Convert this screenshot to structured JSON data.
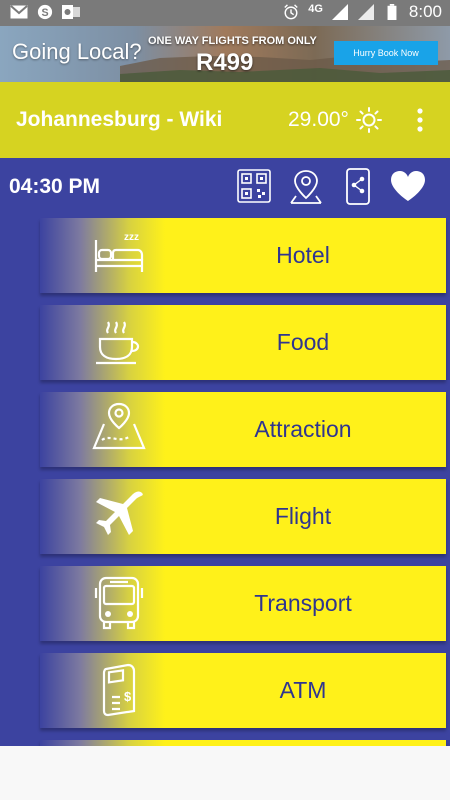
{
  "status_bar": {
    "time": "8:00",
    "network": "4G",
    "icons": [
      "gmail-icon",
      "skype-icon",
      "outlook-icon",
      "alarm-icon",
      "signal-icon",
      "signal-icon",
      "battery-icon"
    ]
  },
  "ad": {
    "title": "Going Local?",
    "subtitle": "ONE WAY FLIGHTS FROM ONLY",
    "price": "R499",
    "cta": "Hurry Book Now"
  },
  "app_bar": {
    "title": "Johannesburg - Wiki",
    "temperature": "29.00°",
    "weather_icon": "sun-icon",
    "menu_icon": "overflow-menu-icon",
    "color": "#d6d321"
  },
  "header": {
    "time": "04:30 PM",
    "tools": [
      "qr-code-icon",
      "location-pin-icon",
      "share-icon",
      "heart-icon"
    ]
  },
  "menu": {
    "items": [
      {
        "label": "Hotel",
        "icon": "bed-icon"
      },
      {
        "label": "Food",
        "icon": "coffee-cup-icon"
      },
      {
        "label": "Attraction",
        "icon": "map-pin-icon"
      },
      {
        "label": "Flight",
        "icon": "airplane-icon"
      },
      {
        "label": "Transport",
        "icon": "bus-icon"
      },
      {
        "label": "ATM",
        "icon": "atm-icon"
      }
    ]
  },
  "colors": {
    "background": "#3c43a0",
    "item_fill": "#fff11a",
    "item_text": "#2f3590"
  }
}
